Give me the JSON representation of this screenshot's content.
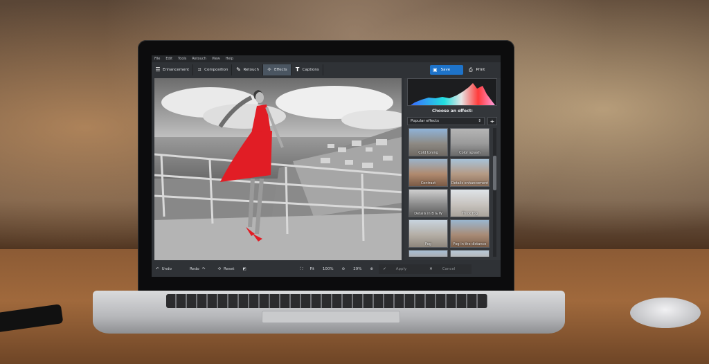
{
  "menu": [
    "File",
    "Edit",
    "Tools",
    "Retouch",
    "View",
    "Help"
  ],
  "tabs": [
    {
      "label": "Enhancement",
      "icon": "sliders-icon",
      "active": false
    },
    {
      "label": "Composition",
      "icon": "crop-icon",
      "active": false
    },
    {
      "label": "Retouch",
      "icon": "brush-icon",
      "active": false
    },
    {
      "label": "Effects",
      "icon": "magic-wand-icon",
      "active": true
    },
    {
      "label": "Captions",
      "icon": "text-icon",
      "active": false
    }
  ],
  "actions": {
    "save": "Save",
    "print": "Print"
  },
  "bottombar": {
    "undo": "Undo",
    "redo": "Redo",
    "reset": "Reset",
    "fit": "Fit",
    "zoom_left": "100%",
    "zoom_right": "29%"
  },
  "panel": {
    "title": "Choose an effect:",
    "dropdown_value": "Popular effects",
    "effects": [
      "Cold toning",
      "Color splash",
      "Contrast",
      "Details enhancement",
      "Details in B & W",
      "Thick fog",
      "Fog",
      "Fog in the distance",
      "",
      ""
    ],
    "apply": "Apply",
    "cancel": "Cancel"
  },
  "colors": {
    "accent": "#1e73c9",
    "dress_red": "#e11d25",
    "panel_bg": "#33363a"
  }
}
